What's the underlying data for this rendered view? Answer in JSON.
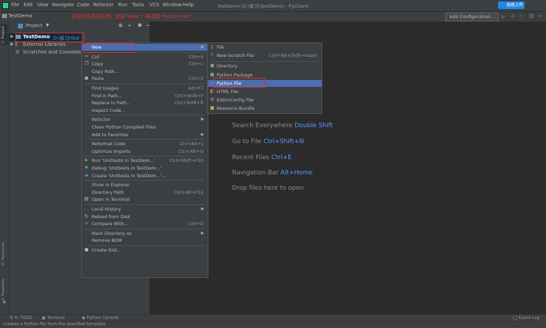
{
  "menubar": {
    "items": [
      "File",
      "Edit",
      "View",
      "Navigate",
      "Code",
      "Refactor",
      "Run",
      "Tools",
      "VCS",
      "Window",
      "Help"
    ],
    "window_title": "TestDemo [D:\\练习\\TestDemo] - PyCharm",
    "upload_button": "拖拽上传"
  },
  "navbar": {
    "breadcrumb": "TestDemo",
    "annotation": "右键点击项目名称，选择“New”，再选择“Python File”",
    "run_config": "Add Configuration..."
  },
  "panel": {
    "title": "Project",
    "side_tab_project": "1: Project",
    "side_tab_structure": "Z: Structure",
    "side_tab_favorites": "2: Favorites"
  },
  "tree": {
    "root_name": "TestDemo",
    "root_path": "D:\\练习\\TestDemo",
    "external": "External Libraries",
    "scratches": "Scratches and Consoles"
  },
  "context_menu": [
    {
      "label": "New",
      "shortcut": "",
      "submenu": true,
      "selected": true,
      "icon": ""
    },
    {
      "label": "Cut",
      "shortcut": "Ctrl+X",
      "icon": "scissors-icon"
    },
    {
      "label": "Copy",
      "shortcut": "Ctrl+C",
      "icon": "copy-icon"
    },
    {
      "label": "Copy Path...",
      "shortcut": ""
    },
    {
      "label": "Paste",
      "shortcut": "Ctrl+V",
      "icon": "paste-icon"
    },
    {
      "label": "Find Usages",
      "shortcut": "Alt+F7"
    },
    {
      "label": "Find in Path...",
      "shortcut": "Ctrl+Shift+F"
    },
    {
      "label": "Replace in Path...",
      "shortcut": "Ctrl+Shift+R"
    },
    {
      "label": "Inspect Code...",
      "shortcut": ""
    },
    {
      "label": "Refactor",
      "shortcut": "",
      "submenu": true
    },
    {
      "label": "Clean Python Compiled Files",
      "shortcut": ""
    },
    {
      "label": "Add to Favorites",
      "shortcut": "",
      "submenu": true
    },
    {
      "label": "Reformat Code",
      "shortcut": "Ctrl+Alt+L"
    },
    {
      "label": "Optimize Imports",
      "shortcut": "Ctrl+Alt+O"
    },
    {
      "label": "Run 'Unittests in TestDem...'",
      "shortcut": "Ctrl+Shift+F10",
      "icon": "run-icon"
    },
    {
      "label": "Debug 'Unittests in TestDem...'",
      "shortcut": "",
      "icon": "debug-icon"
    },
    {
      "label": "Create 'Unittests in TestDem...'...",
      "shortcut": "",
      "icon": "python-icon"
    },
    {
      "label": "Show in Explorer",
      "shortcut": ""
    },
    {
      "label": "Directory Path",
      "shortcut": "Ctrl+Alt+F12"
    },
    {
      "label": "Open in Terminal",
      "shortcut": "",
      "icon": "terminal-icon"
    },
    {
      "label": "Local History",
      "shortcut": "",
      "submenu": true
    },
    {
      "label": "Reload from Disk",
      "shortcut": "",
      "icon": "reload-icon"
    },
    {
      "label": "Compare With...",
      "shortcut": "Ctrl+D",
      "icon": "compare-icon"
    },
    {
      "label": "Mark Directory as",
      "shortcut": "",
      "submenu": true
    },
    {
      "label": "Remove BOM",
      "shortcut": ""
    },
    {
      "label": "Create Gist...",
      "shortcut": "",
      "icon": "github-icon"
    }
  ],
  "submenu": [
    {
      "label": "File",
      "shortcut": ""
    },
    {
      "label": "New Scratch File",
      "shortcut": "Ctrl+Alt+Shift+Insert"
    },
    {
      "label": "Directory",
      "shortcut": ""
    },
    {
      "label": "Python Package",
      "shortcut": ""
    },
    {
      "label": "Python File",
      "shortcut": "",
      "selected": true
    },
    {
      "label": "HTML File",
      "shortcut": ""
    },
    {
      "label": "EditorConfig File",
      "shortcut": ""
    },
    {
      "label": "Resource Bundle",
      "shortcut": ""
    }
  ],
  "editor_hints": [
    {
      "text": "Search Everywhere",
      "key": "Double Shift"
    },
    {
      "text": "Go to File",
      "key": "Ctrl+Shift+N"
    },
    {
      "text": "Recent Files",
      "key": "Ctrl+E"
    },
    {
      "text": "Navigation Bar",
      "key": "Alt+Home"
    },
    {
      "text": "Drop files here to open",
      "key": ""
    }
  ],
  "bottom_tabs": {
    "todo": "6: TODO",
    "terminal": "Terminal",
    "console": "Python Console",
    "event_log": "Event Log"
  },
  "status_text": "Creates a Python file from the specified template",
  "colors": {
    "selection": "#4b6eaf",
    "annotation_red": "#e03030",
    "link_blue": "#589df6"
  }
}
